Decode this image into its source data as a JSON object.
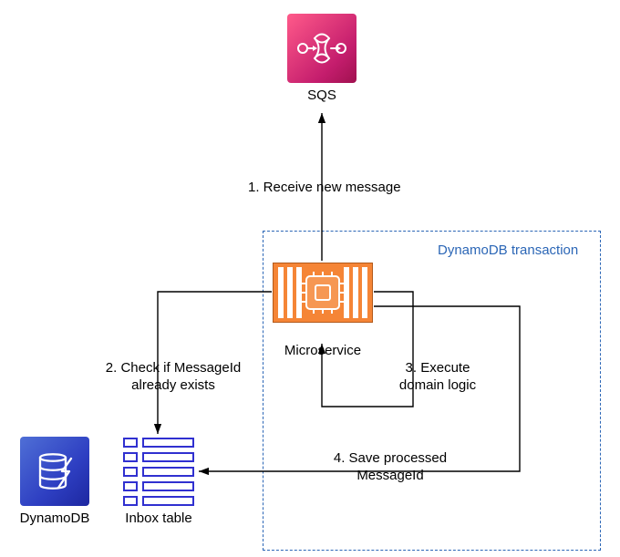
{
  "icons": {
    "sqs": {
      "label": "SQS"
    },
    "microservice": {
      "label": "Microservice"
    },
    "dynamodb": {
      "label": "DynamoDB"
    },
    "inbox_table": {
      "label": "Inbox table"
    }
  },
  "transaction": {
    "label": "DynamoDB transaction"
  },
  "steps": {
    "s1": "1. Receive new message",
    "s2_l1": "2. Check if MessageId",
    "s2_l2": "already exists",
    "s3_l1": "3. Execute",
    "s3_l2": "domain logic",
    "s4_l1": "4. Save processed",
    "s4_l2": "MessageId"
  }
}
